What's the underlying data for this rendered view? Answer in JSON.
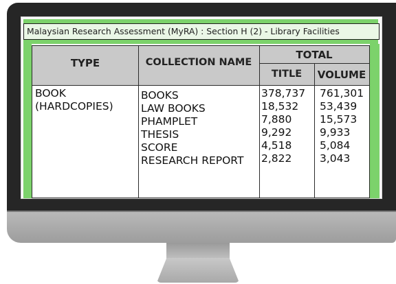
{
  "page": {
    "title": "Malaysian Research Assessment (MyRA) : Section H (2) - Library Facilities"
  },
  "table": {
    "headers": {
      "type": "TYPE",
      "collection": "COLLECTION NAME",
      "total": "TOTAL",
      "title": "TITLE",
      "volume": "VOLUME"
    },
    "type_lines": [
      "BOOK",
      "(HARDCOPIES)"
    ],
    "rows": [
      {
        "collection": "BOOKS",
        "title": "378,737",
        "volume": "761,301"
      },
      {
        "collection": "LAW BOOKS",
        "title": "18,532",
        "volume": "53,439"
      },
      {
        "collection": "PHAMPLET",
        "title": "7,880",
        "volume": "15,573"
      },
      {
        "collection": "THESIS",
        "title": "9,292",
        "volume": "9,933"
      },
      {
        "collection": "SCORE",
        "title": "4,518",
        "volume": "5,084"
      },
      {
        "collection": "RESEARCH REPORT",
        "title": "2,822",
        "volume": "3,043"
      }
    ]
  },
  "colors": {
    "accent_green": "#7cd26b",
    "header_gray": "#c9c9c9",
    "monitor_bezel": "#262626"
  }
}
